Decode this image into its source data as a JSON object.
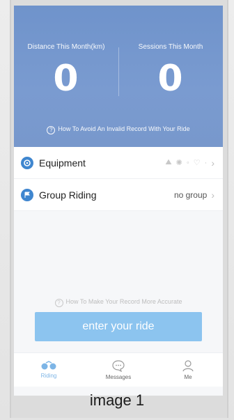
{
  "stats": {
    "distance_label": "Distance This Month(km)",
    "distance_value": "0",
    "sessions_label": "Sessions This Month",
    "sessions_value": "0"
  },
  "tips": {
    "hero": "How To Avoid An Invalid Record With Your Ride",
    "bottom": "How To Make Your Record More Accurate"
  },
  "list": {
    "equipment_label": "Equipment",
    "group_label": "Group Riding",
    "group_value": "no group"
  },
  "actions": {
    "enter_ride": "enter your ride"
  },
  "tabs": {
    "riding": "Riding",
    "messages": "Messages",
    "me": "Me"
  },
  "caption": "image 1",
  "colors": {
    "hero_bg": "#7498cf",
    "accent": "#3f86cf",
    "button_bg": "#8cc4ef"
  }
}
